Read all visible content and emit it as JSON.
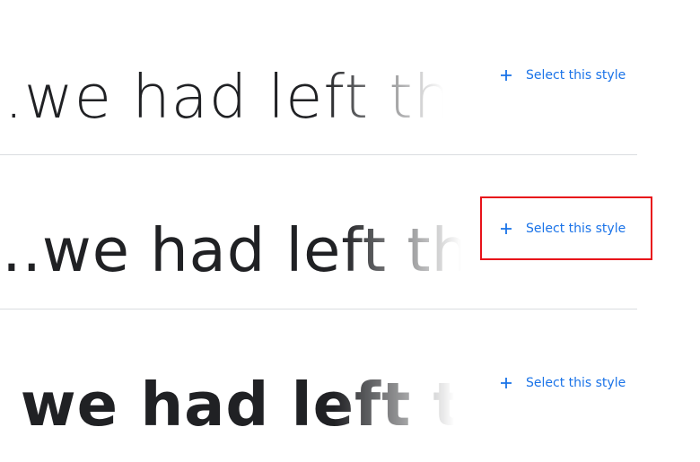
{
  "rows": [
    {
      "preview_text": "...we had left the ground",
      "action_label": "Select this style",
      "action_icon": "plus-icon"
    },
    {
      "preview_text": "...we had left the ground",
      "action_label": "Select this style",
      "action_icon": "plus-icon"
    },
    {
      "preview_text": ", we had left the ground",
      "action_label": "Select this style",
      "action_icon": "plus-icon"
    }
  ],
  "colors": {
    "accent": "#1a73e8",
    "text": "#202124",
    "divider": "#dadce0",
    "highlight": "#e8121a"
  }
}
